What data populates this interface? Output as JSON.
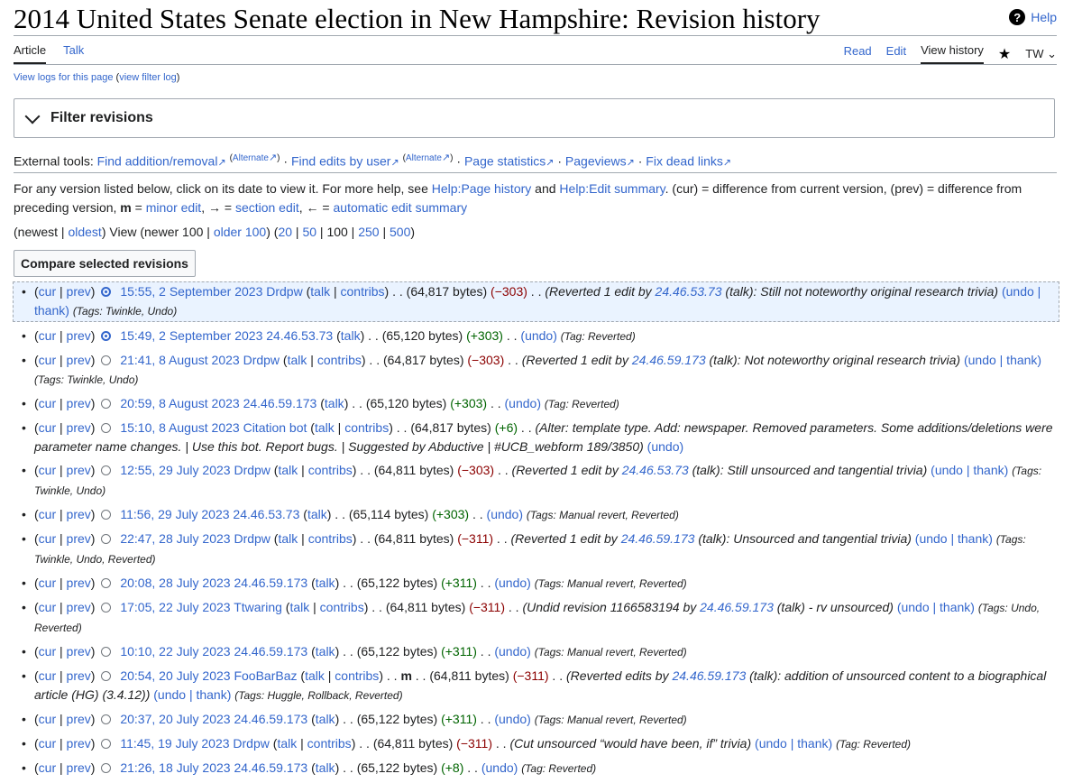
{
  "header": {
    "title": "2014 United States Senate election in New Hampshire: Revision history",
    "help": "Help",
    "tab_article": "Article",
    "tab_talk": "Talk",
    "tab_read": "Read",
    "tab_edit": "Edit",
    "tab_history": "View history",
    "tw": "TW"
  },
  "view_logs": "View logs for this page",
  "view_filter_log": "view filter log",
  "filter_title": "Filter revisions",
  "external_tools": {
    "label": "External tools:",
    "find_addition": "Find addition/removal",
    "alternate": "Alternate",
    "find_user": "Find edits by user",
    "page_stats": "Page statistics",
    "pageviews": "Pageviews",
    "dead_links": "Fix dead links"
  },
  "legend": {
    "p1": "For any version listed below, click on its date to view it. For more help, see",
    "help_history": "Help:Page history",
    "and": "and",
    "help_summary": "Help:Edit summary",
    "p2": ". (cur) = difference from current version, (prev) = difference from preceding version,",
    "m": "m",
    "eq": "=",
    "minor": "minor edit",
    "arrow": ", → =",
    "section": "section edit",
    "larrow": ", ← =",
    "auto": "automatic edit summary"
  },
  "nav": {
    "newest": "newest",
    "oldest": "oldest",
    "view": "View (newer 100",
    "older": "older 100",
    "n20": "20",
    "n50": "50",
    "n100": "100",
    "n250": "250",
    "n500": "500"
  },
  "compare_button": "Compare selected revisions",
  "revisions": [
    {
      "date": "15:55, 2 September 2023",
      "user": "Drdpw",
      "talk": "talk",
      "contribs": "contribs",
      "bytes": "(64,817 bytes)",
      "diff": "(−303)",
      "sign": "neg",
      "comment": "(Reverted 1 edit by",
      "target": "24.46.53.73",
      "comment2": "(talk): Still not noteworthy original research trivia)",
      "actions": "(undo | thank)",
      "tags": "(Tags: Twinkle, Undo)"
    },
    {
      "date": "15:49, 2 September 2023",
      "user": "24.46.53.73",
      "talk": "talk",
      "bytes": "(65,120 bytes)",
      "diff": "(+303)",
      "sign": "pos",
      "actions": "(undo)",
      "tags": "(Tag: Reverted)"
    },
    {
      "date": "21:41, 8 August 2023",
      "user": "Drdpw",
      "talk": "talk",
      "contribs": "contribs",
      "bytes": "(64,817 bytes)",
      "diff": "(−303)",
      "sign": "neg",
      "comment": "(Reverted 1 edit by",
      "target": "24.46.59.173",
      "comment2": "(talk): Not noteworthy original research trivia)",
      "actions": "(undo | thank)",
      "tags": "(Tags: Twinkle, Undo)"
    },
    {
      "date": "20:59, 8 August 2023",
      "user": "24.46.59.173",
      "talk": "talk",
      "bytes": "(65,120 bytes)",
      "diff": "(+303)",
      "sign": "pos",
      "actions": "(undo)",
      "tags": "(Tag: Reverted)"
    },
    {
      "date": "15:10, 8 August 2023",
      "user": "Citation bot",
      "talk": "talk",
      "contribs": "contribs",
      "bytes": "(64,817 bytes)",
      "diff": "(+6)",
      "sign": "pos",
      "comment": "(Alter: template type. Add: newspaper. Removed parameters. Some additions/deletions were parameter name changes. | Use this bot. Report bugs. | Suggested by Abductive | #UCB_webform 189/3850)",
      "actions": "(undo)"
    },
    {
      "date": "12:55, 29 July 2023",
      "user": "Drdpw",
      "talk": "talk",
      "contribs": "contribs",
      "bytes": "(64,811 bytes)",
      "diff": "(−303)",
      "sign": "neg",
      "comment": "(Reverted 1 edit by",
      "target": "24.46.53.73",
      "comment2": "(talk): Still unsourced and tangential trivia)",
      "actions": "(undo | thank)",
      "tags": "(Tags: Twinkle, Undo)"
    },
    {
      "date": "11:56, 29 July 2023",
      "user": "24.46.53.73",
      "talk": "talk",
      "bytes": "(65,114 bytes)",
      "diff": "(+303)",
      "sign": "pos",
      "actions": "(undo)",
      "tags": "(Tags: Manual revert, Reverted)"
    },
    {
      "date": "22:47, 28 July 2023",
      "user": "Drdpw",
      "talk": "talk",
      "contribs": "contribs",
      "bytes": "(64,811 bytes)",
      "diff": "(−311)",
      "sign": "neg",
      "comment": "(Reverted 1 edit by",
      "target": "24.46.59.173",
      "comment2": "(talk): Unsourced and tangential trivia)",
      "actions": "(undo | thank)",
      "tags": "(Tags: Twinkle, Undo, Reverted)"
    },
    {
      "date": "20:08, 28 July 2023",
      "user": "24.46.59.173",
      "talk": "talk",
      "bytes": "(65,122 bytes)",
      "diff": "(+311)",
      "sign": "pos",
      "actions": "(undo)",
      "tags": "(Tags: Manual revert, Reverted)"
    },
    {
      "date": "17:05, 22 July 2023",
      "user": "Ttwaring",
      "talk": "talk",
      "contribs": "contribs",
      "bytes": "(64,811 bytes)",
      "diff": "(−311)",
      "sign": "neg",
      "comment": "(Undid revision 1166583194 by",
      "target": "24.46.59.173",
      "comment2": "(talk) - rv unsourced)",
      "actions": "(undo | thank)",
      "tags": "(Tags: Undo, Reverted)"
    },
    {
      "date": "10:10, 22 July 2023",
      "user": "24.46.59.173",
      "talk": "talk",
      "bytes": "(65,122 bytes)",
      "diff": "(+311)",
      "sign": "pos",
      "actions": "(undo)",
      "tags": "(Tags: Manual revert, Reverted)"
    },
    {
      "date": "20:54, 20 July 2023",
      "user": "FooBarBaz",
      "talk": "talk",
      "contribs": "contribs",
      "minor": "m",
      "bytes": "(64,811 bytes)",
      "diff": "(−311)",
      "sign": "neg",
      "comment": "(Reverted edits by",
      "target": "24.46.59.173",
      "comment2": "(talk): addition of unsourced content to a biographical article (HG) (3.4.12))",
      "actions": "(undo | thank)",
      "tags": "(Tags: Huggle, Rollback, Reverted)"
    },
    {
      "date": "20:37, 20 July 2023",
      "user": "24.46.59.173",
      "talk": "talk",
      "bytes": "(65,122 bytes)",
      "diff": "(+311)",
      "sign": "pos",
      "actions": "(undo)",
      "tags": "(Tags: Manual revert, Reverted)"
    },
    {
      "date": "11:45, 19 July 2023",
      "user": "Drdpw",
      "talk": "talk",
      "contribs": "contribs",
      "bytes": "(64,811 bytes)",
      "diff": "(−311)",
      "sign": "neg",
      "comment": "(Cut unsourced “would have been, if” trivia)",
      "actions": "(undo | thank)",
      "tags": "(Tag: Reverted)"
    },
    {
      "date": "21:26, 18 July 2023",
      "user": "24.46.59.173",
      "talk": "talk",
      "bytes": "(65,122 bytes)",
      "diff": "(+8)",
      "sign": "pos",
      "actions": "(undo)",
      "tags": "(Tag: Reverted)"
    }
  ]
}
